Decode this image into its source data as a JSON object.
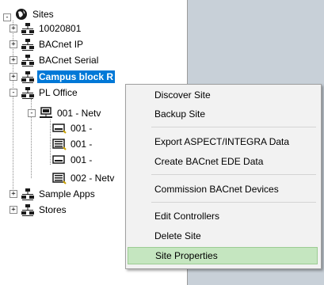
{
  "tree": {
    "root": {
      "label": "Sites",
      "icon": "globe-icon"
    },
    "items": [
      {
        "label": "10020801",
        "icon": "site-network-icon",
        "expander": "+"
      },
      {
        "label": "BACnet IP",
        "icon": "site-network-icon",
        "expander": "+"
      },
      {
        "label": "BACnet Serial",
        "icon": "site-network-icon",
        "expander": "+"
      },
      {
        "label": "Campus block R",
        "icon": "site-network-icon",
        "expander": "+",
        "selected": true
      },
      {
        "label": "PL Office",
        "icon": "site-network-icon",
        "expander": "-"
      },
      {
        "label": "001 - Netv",
        "icon": "network-icon",
        "expander": "-"
      },
      {
        "label": "001 -",
        "icon": "controller-icon"
      },
      {
        "label": "001 -",
        "icon": "controller-icon"
      },
      {
        "label": "001 -",
        "icon": "controller-icon"
      },
      {
        "label": "002 - Netv",
        "icon": "network-icon"
      },
      {
        "label": "Sample Apps",
        "icon": "site-network-icon",
        "expander": "+"
      },
      {
        "label": "Stores",
        "icon": "site-network-icon",
        "expander": "+"
      }
    ]
  },
  "context_menu": {
    "items": [
      {
        "label": "Discover Site"
      },
      {
        "label": "Backup Site"
      },
      {
        "label": "Export ASPECT/INTEGRA Data"
      },
      {
        "label": "Create BACnet EDE Data"
      },
      {
        "label": "Commission BACnet Devices"
      },
      {
        "label": "Edit Controllers"
      },
      {
        "label": "Delete Site"
      },
      {
        "label": "Site Properties",
        "highlighted": true
      }
    ]
  },
  "colors": {
    "selection": "#0078d7",
    "menu_highlight": "#c5e6c0",
    "right_pane": "#c8d0d8"
  }
}
